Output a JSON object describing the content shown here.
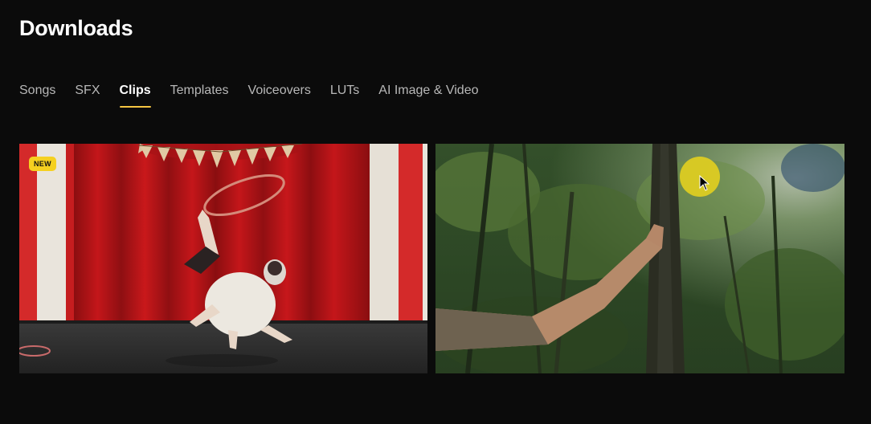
{
  "page": {
    "title": "Downloads"
  },
  "tabs": [
    {
      "label": "Songs",
      "active": false
    },
    {
      "label": "SFX",
      "active": false
    },
    {
      "label": "Clips",
      "active": true
    },
    {
      "label": "Templates",
      "active": false
    },
    {
      "label": "Voiceovers",
      "active": false
    },
    {
      "label": "LUTs",
      "active": false
    },
    {
      "label": "AI Image & Video",
      "active": false
    }
  ],
  "clips": [
    {
      "badge": "NEW",
      "scene": "circus-stage-hoop-performer"
    },
    {
      "badge": "",
      "scene": "jungle-arm-on-tree"
    }
  ],
  "colors": {
    "background": "#0b0b0b",
    "accent": "#f5c542",
    "badge": "#f5d020",
    "tab_inactive": "#b8b8b8"
  }
}
